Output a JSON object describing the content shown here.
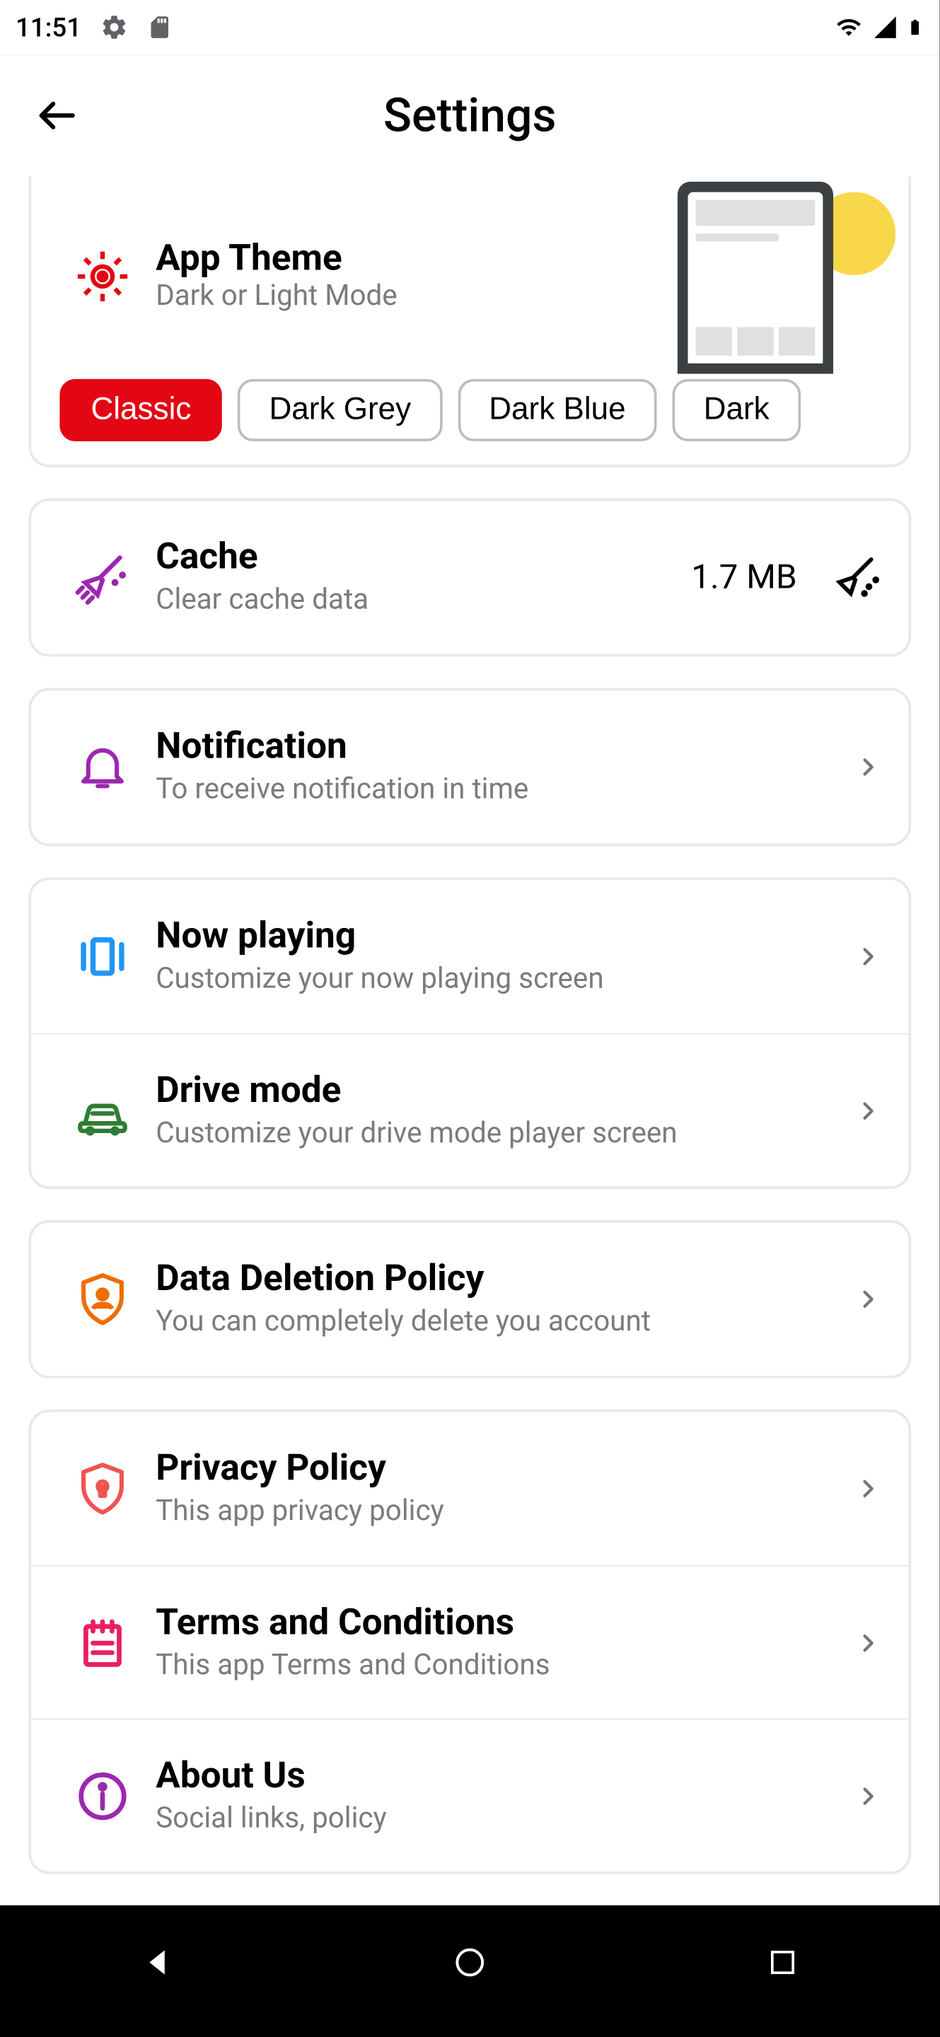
{
  "status_bar": {
    "time": "11:51"
  },
  "header": {
    "title": "Settings"
  },
  "theme": {
    "title": "App Theme",
    "subtitle": "Dark or Light Mode",
    "options": [
      "Classic",
      "Dark Grey",
      "Dark Blue",
      "Dark"
    ],
    "active_index": 0
  },
  "cache": {
    "title": "Cache",
    "subtitle": "Clear cache data",
    "size": "1.7 MB"
  },
  "notification": {
    "title": "Notification",
    "subtitle": "To receive notification in time"
  },
  "now_playing": {
    "title": "Now playing",
    "subtitle": "Customize your now playing screen"
  },
  "drive_mode": {
    "title": "Drive mode",
    "subtitle": "Customize your drive mode player screen"
  },
  "data_deletion": {
    "title": "Data Deletion Policy",
    "subtitle": "You can completely delete you account"
  },
  "privacy": {
    "title": "Privacy Policy",
    "subtitle": "This app privacy policy"
  },
  "terms": {
    "title": "Terms and Conditions",
    "subtitle": "This app Terms and Conditions"
  },
  "about": {
    "title": "About Us",
    "subtitle": "Social links, policy"
  },
  "colors": {
    "accent": "#e30613",
    "purple": "#9c27b0",
    "blue": "#2196f3",
    "green": "#2e7d32",
    "orange": "#ef6c00",
    "pink": "#e91e63"
  }
}
